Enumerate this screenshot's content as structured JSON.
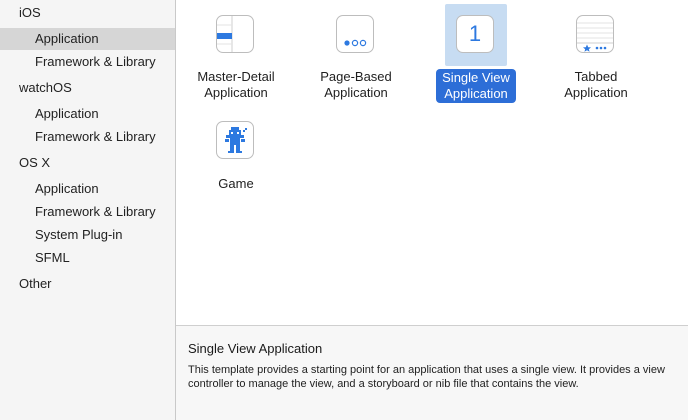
{
  "sidebar": {
    "groups": [
      {
        "label": "iOS",
        "items": [
          "Application",
          "Framework & Library"
        ]
      },
      {
        "label": "watchOS",
        "items": [
          "Application",
          "Framework & Library"
        ]
      },
      {
        "label": "OS X",
        "items": [
          "Application",
          "Framework & Library",
          "System Plug-in",
          "SFML"
        ]
      },
      {
        "label": "Other",
        "items": []
      }
    ],
    "selected": "iOS / Application"
  },
  "templates": [
    {
      "line1": "Master-Detail",
      "line2": "Application",
      "icon": "master-detail-icon"
    },
    {
      "line1": "Page-Based",
      "line2": "Application",
      "icon": "page-based-icon"
    },
    {
      "line1": "Single View",
      "line2": "Application",
      "icon": "single-view-icon",
      "icon_text": "1",
      "selected": true
    },
    {
      "line1": "Tabbed",
      "line2": "Application",
      "icon": "tabbed-icon"
    },
    {
      "line1": "Game",
      "line2": "",
      "icon": "game-icon"
    }
  ],
  "description": {
    "title": "Single View Application",
    "body": "This template provides a starting point for an application that uses a single view. It provides a view controller to manage the view, and a storyboard or nib file that contains the view."
  },
  "colors": {
    "accent": "#2d6ed7",
    "selection_highlight": "#c7dcf2",
    "sidebar_selected": "#d6d6d6"
  }
}
